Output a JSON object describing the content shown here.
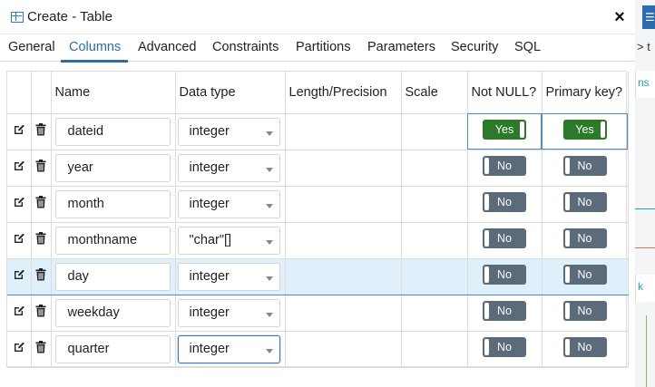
{
  "dialog": {
    "title": "Create - Table",
    "close_label": "×"
  },
  "tabs": [
    {
      "label": "General"
    },
    {
      "label": "Columns"
    },
    {
      "label": "Advanced"
    },
    {
      "label": "Constraints"
    },
    {
      "label": "Partitions"
    },
    {
      "label": "Parameters"
    },
    {
      "label": "Security"
    },
    {
      "label": "SQL"
    }
  ],
  "active_tab": "Columns",
  "columns_grid": {
    "headers": {
      "name": "Name",
      "data_type": "Data type",
      "length": "Length/Precision",
      "scale": "Scale",
      "not_null": "Not NULL?",
      "primary_key": "Primary key?"
    },
    "rows": [
      {
        "name": "dateid",
        "data_type": "integer",
        "not_null": "Yes",
        "primary_key": "Yes"
      },
      {
        "name": "year",
        "data_type": "integer",
        "not_null": "No",
        "primary_key": "No"
      },
      {
        "name": "month",
        "data_type": "integer",
        "not_null": "No",
        "primary_key": "No"
      },
      {
        "name": "monthname",
        "data_type": "\"char\"[]",
        "not_null": "No",
        "primary_key": "No"
      },
      {
        "name": "day",
        "data_type": "integer",
        "not_null": "No",
        "primary_key": "No"
      },
      {
        "name": "weekday",
        "data_type": "integer",
        "not_null": "No",
        "primary_key": "No"
      },
      {
        "name": "quarter",
        "data_type": "integer",
        "not_null": "No",
        "primary_key": "No"
      }
    ],
    "selected_row": "day"
  },
  "backdrop": {
    "top_button": "☰",
    "row_text_1": "> t",
    "row_text_2": "ns",
    "row_text_3": "k"
  },
  "colors": {
    "accent": "#2b6cb0",
    "toggle_yes": "#2a7a2a",
    "toggle_no": "#5b6b7a",
    "selected_row": "#e0f0fb"
  },
  "icons": {
    "edit": "edit-icon",
    "delete": "trash-icon",
    "table": "table-icon",
    "close": "close-icon",
    "dropdown": "chevron-down-icon"
  }
}
